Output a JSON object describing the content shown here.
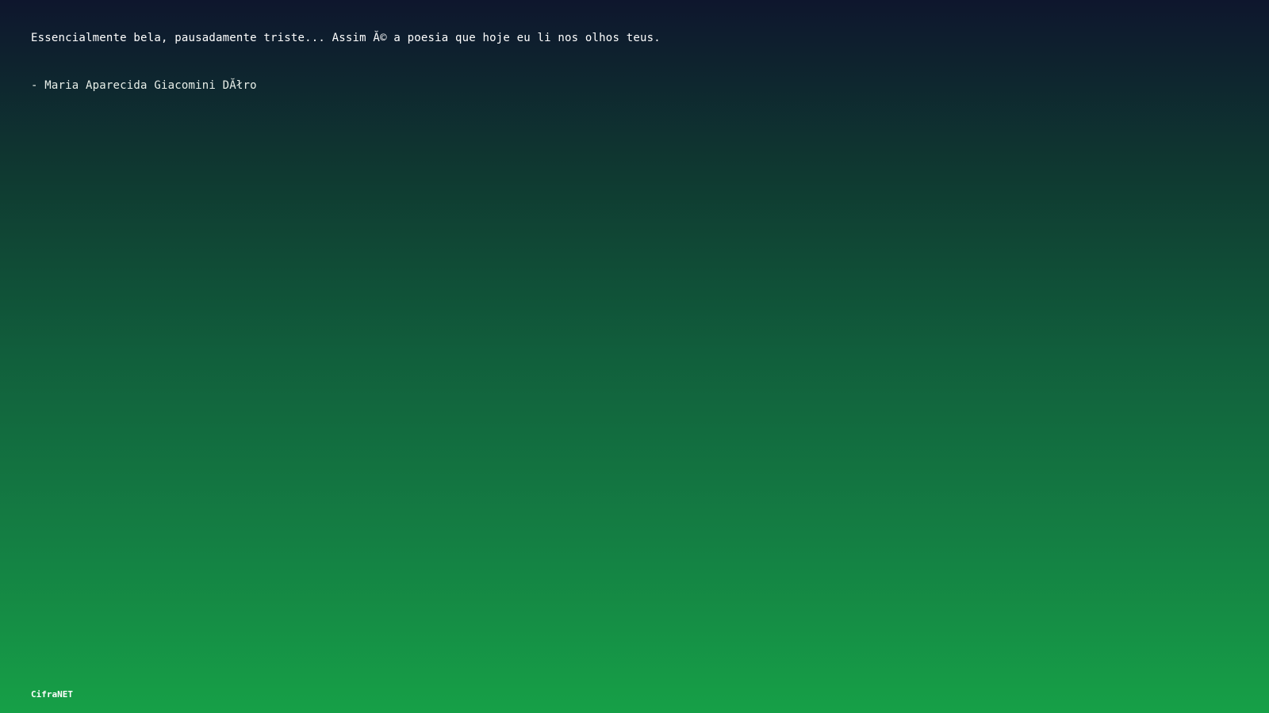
{
  "quote": {
    "text": "Essencialmente bela, pausadamente triste... Assim Ă© a poesia que hoje eu li nos olhos teus.",
    "author": "- Maria Aparecida Giacomini DĂłro"
  },
  "footer": {
    "brand": "CifraNET"
  },
  "colors": {
    "gradient_top": "#0e162d",
    "gradient_bottom": "#16a047",
    "text": "#ffffff"
  }
}
